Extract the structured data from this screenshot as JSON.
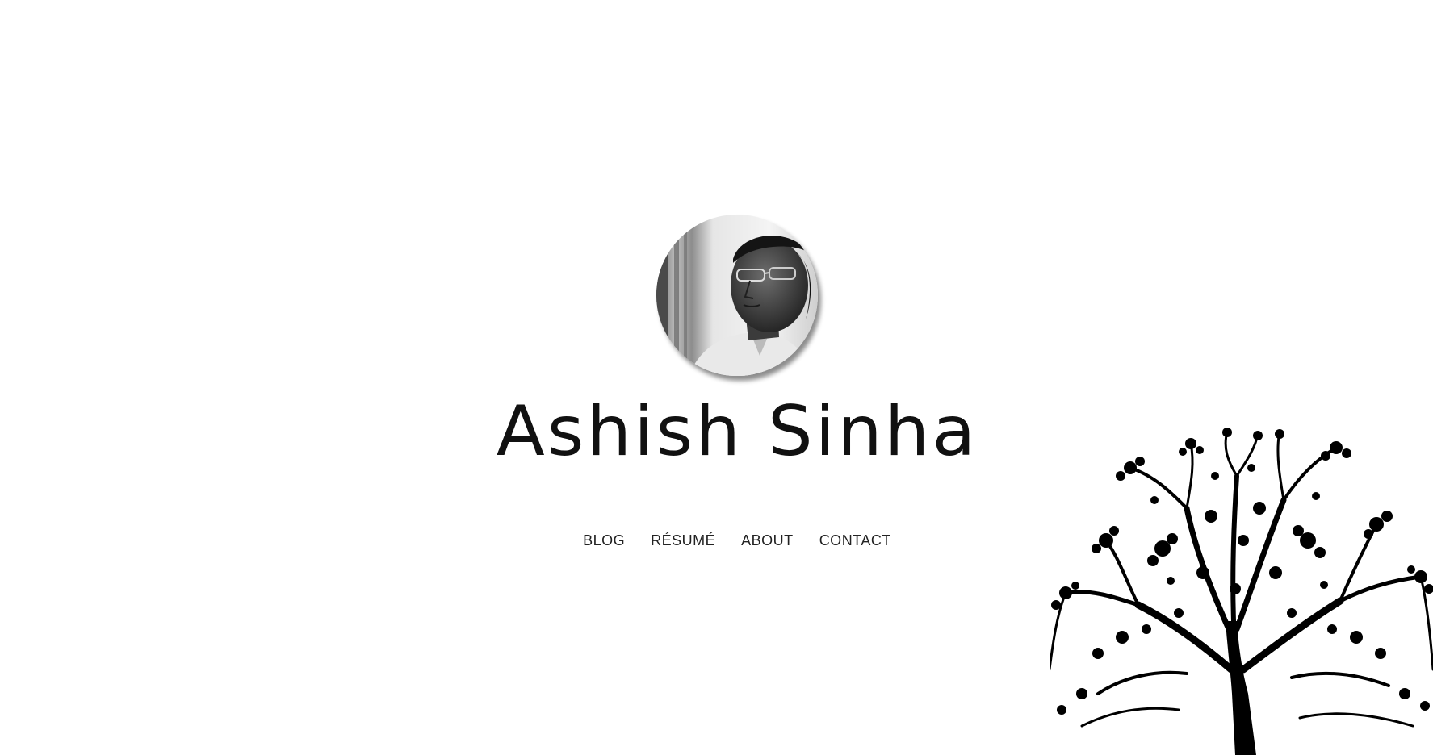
{
  "site": {
    "title": "Ashish Sinha"
  },
  "nav": {
    "items": [
      {
        "label": "BLOG"
      },
      {
        "label": "RÉSUMÉ"
      },
      {
        "label": "ABOUT"
      },
      {
        "label": "CONTACT"
      }
    ]
  },
  "icons": {
    "avatar": "profile-photo",
    "decoration": "tree-silhouette"
  },
  "colors": {
    "background": "#ffffff",
    "text": "#111111"
  }
}
